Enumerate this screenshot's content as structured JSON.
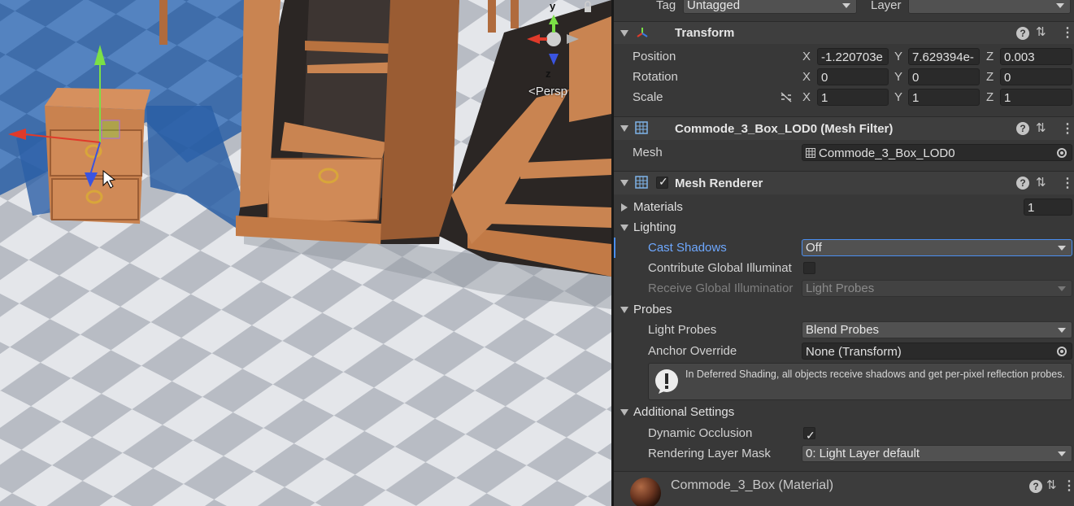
{
  "scene": {
    "persp_label": "Persp",
    "gizmo_axes": {
      "y": "y",
      "z": "z"
    }
  },
  "header": {
    "tag_label": "Tag",
    "tag_value": "Untagged",
    "layer_label": "Layer",
    "layer_value": ""
  },
  "transform": {
    "title": "Transform",
    "position": {
      "label": "Position",
      "x": "-1.220703e",
      "y": "7.629394e-",
      "z": "0.003"
    },
    "rotation": {
      "label": "Rotation",
      "x": "0",
      "y": "0",
      "z": "0"
    },
    "scale": {
      "label": "Scale",
      "x": "1",
      "y": "1",
      "z": "1"
    },
    "axis": {
      "x": "X",
      "y": "Y",
      "z": "Z"
    }
  },
  "mesh_filter": {
    "title": "Commode_3_Box_LOD0 (Mesh Filter)",
    "mesh_label": "Mesh",
    "mesh_value": "Commode_3_Box_LOD0"
  },
  "mesh_renderer": {
    "title": "Mesh Renderer",
    "materials": {
      "label": "Materials",
      "count": "1"
    },
    "lighting": {
      "label": "Lighting",
      "cast_shadows": {
        "label": "Cast Shadows",
        "value": "Off"
      },
      "contribute_gi": {
        "label": "Contribute Global Illuminat"
      },
      "receive_gi": {
        "label": "Receive Global Illuminatior",
        "value": "Light Probes"
      }
    },
    "probes": {
      "label": "Probes",
      "light_probes": {
        "label": "Light Probes",
        "value": "Blend Probes"
      },
      "anchor_override": {
        "label": "Anchor Override",
        "value": "None (Transform)"
      },
      "info": "In Deferred Shading, all objects receive shadows and get per-pixel reflection probes."
    },
    "additional": {
      "label": "Additional Settings",
      "dynamic_occlusion": {
        "label": "Dynamic Occlusion"
      },
      "rendering_layer_mask": {
        "label": "Rendering Layer Mask",
        "value": "0: Light Layer default"
      }
    }
  },
  "material": {
    "title": "Commode_3_Box (Material)"
  },
  "colors": {
    "accent_blue": "#6ea8ff",
    "panel_bg": "#383838"
  },
  "icons": [
    "transform-icon",
    "mesh-filter-icon",
    "mesh-renderer-icon",
    "help-icon",
    "presets-icon",
    "kebab-menu-icon",
    "object-picker-icon",
    "info-icon",
    "unlink-scale-icon",
    "material-sphere-icon"
  ]
}
